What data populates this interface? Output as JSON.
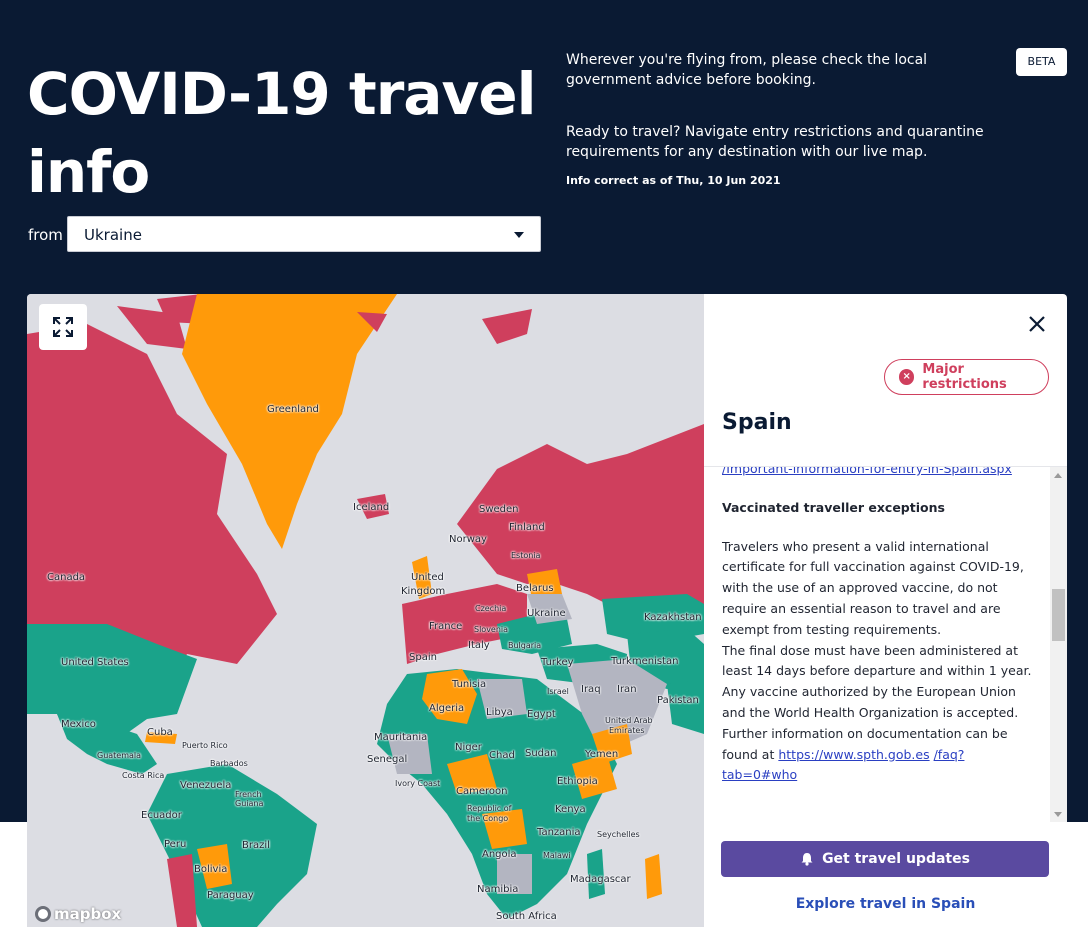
{
  "header": {
    "title": "COVID-19 travel info",
    "from_label": "from",
    "from_selected": "Ukraine",
    "intro_1": "Wherever you're flying from, please check the local government advice before booking.",
    "intro_2": "Ready to travel? Navigate entry restrictions and quarantine requirements for any destination with our live map.",
    "updated": "Info correct as of Thu, 10 Jun 2021",
    "beta": "BETA"
  },
  "colors": {
    "header_bg": "#0a1a33",
    "major_restrictions": "#cf3f5d",
    "moderate_restrictions": "#ff9a0a",
    "open": "#1aa38a",
    "no_info": "#b3b5c1",
    "cta": "#5a4aa0"
  },
  "map": {
    "expand_icon": "expand-icon",
    "attribution": "mapbox",
    "labels": [
      "Greenland",
      "Iceland",
      "Canada",
      "Sweden",
      "Finland",
      "Norway",
      "Estonia",
      "United",
      "Kingdom",
      "Belarus",
      "Czechia",
      "Ukraine",
      "Kazakhstan",
      "France",
      "Slovenia",
      "Italy",
      "Bulgaria",
      "Spain",
      "Turkey",
      "Turkmenistan",
      "United States",
      "Tunisia",
      "Iraq",
      "Iran",
      "Israel",
      "Algeria",
      "Libya",
      "Egypt",
      "Pakistan",
      "Mexico",
      "United Arab",
      "Emirates",
      "Cuba",
      "Puerto Rico",
      "Mauritania",
      "Niger",
      "Chad",
      "Sudan",
      "Yemen",
      "Guatemala",
      "Barbados",
      "Senegal",
      "Costa Rica",
      "Venezuela",
      "French",
      "Guiana",
      "Ivory Coast",
      "Cameroon",
      "Ethiopia",
      "Ecuador",
      "Republic of",
      "the Congo",
      "Kenya",
      "Peru",
      "Brazil",
      "Tanzania",
      "Seychelles",
      "Malawi",
      "Angola",
      "Bolivia",
      "Madagascar",
      "Namibia",
      "Paraguay",
      "South Africa"
    ]
  },
  "panel": {
    "country": "Spain",
    "status": "Major restrictions",
    "link_1": "/Important-information-for-entry-in-Spain.aspx",
    "section_heading": "Vaccinated traveller exceptions",
    "para_1": "Travelers who present a valid international certificate for full vaccination against COVID-19, with the use of an approved vaccine, do not require an essential reason to travel and are exempt from testing requirements.",
    "para_2": "The final dose must have been administered at least 14 days before departure and within 1 year. Any vaccine authorized by the European Union and the World Health Organization is accepted. Further information on documentation can be found at",
    "link_2": "https://www.spth.gob.es",
    "link_3": "/faq?tab=0#who",
    "cta": "Get travel updates",
    "explore": "Explore travel in Spain"
  }
}
